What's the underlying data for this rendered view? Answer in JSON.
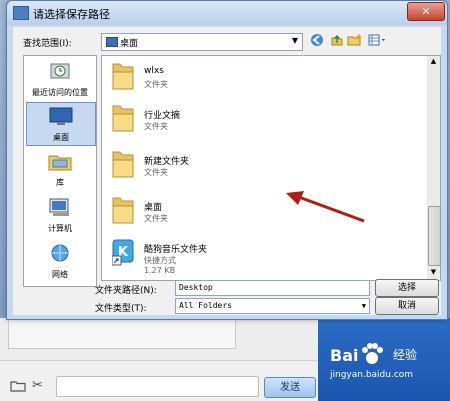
{
  "dialog": {
    "title": "请选择保存路径",
    "look_in_label": "查找范围(I):",
    "look_in_value": "桌面",
    "close_label": "✕"
  },
  "places": [
    {
      "label": "最近访问的位置",
      "icon": "recent-places-icon"
    },
    {
      "label": "桌面",
      "icon": "desktop-icon",
      "selected": true
    },
    {
      "label": "库",
      "icon": "library-icon"
    },
    {
      "label": "计算机",
      "icon": "computer-icon"
    },
    {
      "label": "网络",
      "icon": "network-icon"
    }
  ],
  "files": [
    {
      "name": "wlxs",
      "type": "文件夹"
    },
    {
      "name": "行业文摘",
      "type": "文件夹"
    },
    {
      "name": "新建文件夹",
      "type": "文件夹"
    },
    {
      "name": "桌面",
      "type": "文件夹"
    },
    {
      "name": "酷狗音乐文件夹",
      "type": "快捷方式",
      "size": "1.27 KB"
    }
  ],
  "footer": {
    "path_label": "文件夹路径(N):",
    "path_value": "Desktop",
    "type_label": "文件类型(T):",
    "type_value": "All Folders",
    "select_button": "选择",
    "cancel_button": "取消"
  },
  "chat": {
    "send_label": "发送"
  },
  "watermark": {
    "logo": "Bai",
    "logo2": "经验",
    "url": "jingyan.baidu.com"
  }
}
